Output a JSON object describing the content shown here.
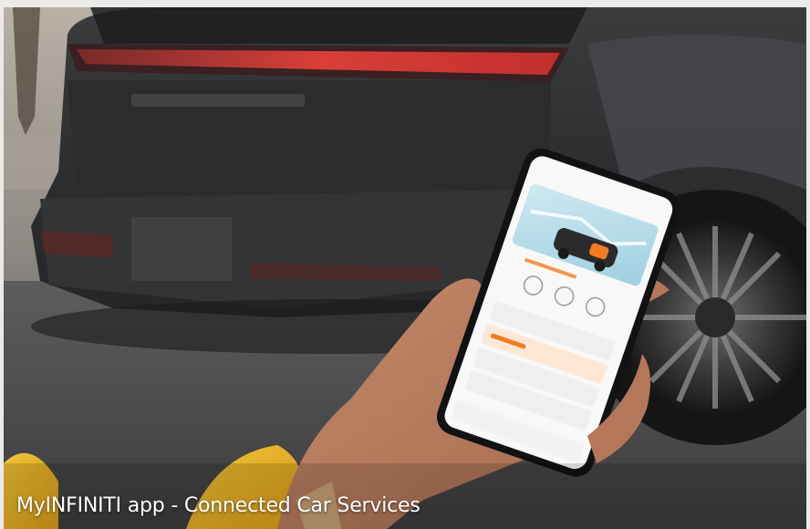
{
  "image": {
    "caption": "MyINFINITI app - Connected Car Services",
    "frame_color": "#eceae8",
    "vehicle_color": "#2f3031",
    "taillight_color": "#e2403a",
    "app_accent_color": "#f47c20"
  }
}
